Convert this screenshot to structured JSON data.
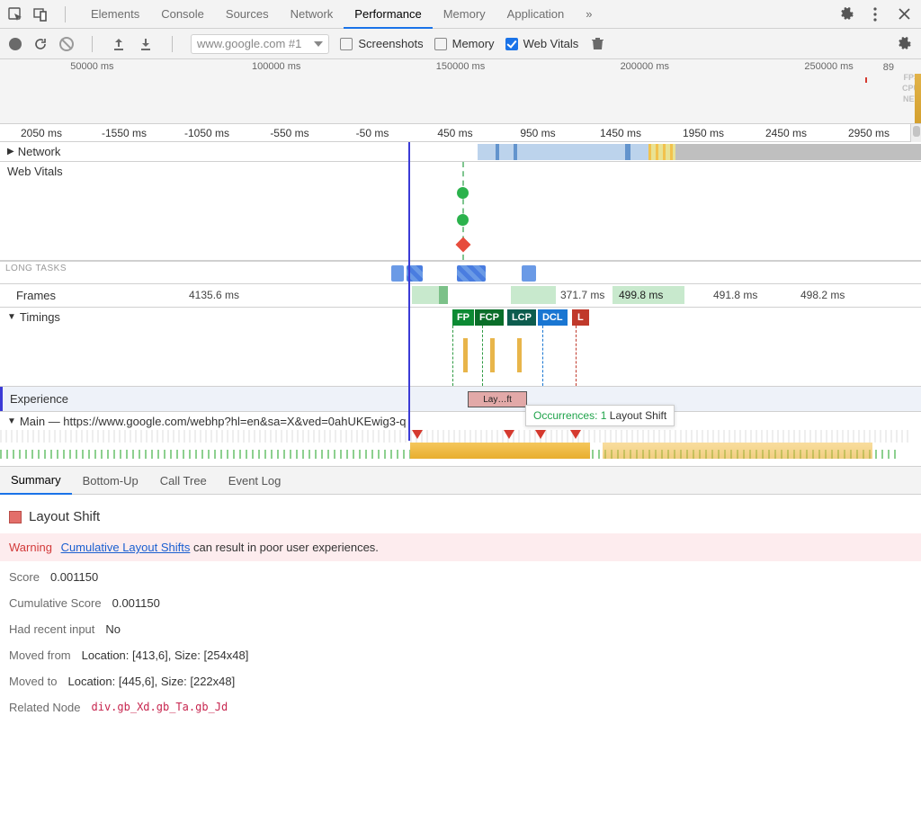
{
  "tabs": {
    "items": [
      "Elements",
      "Console",
      "Sources",
      "Network",
      "Performance",
      "Memory",
      "Application"
    ],
    "active": "Performance"
  },
  "toolbar": {
    "url": "www.google.com #1",
    "screenshots": "Screenshots",
    "memory": "Memory",
    "webvitals": "Web Vitals"
  },
  "overview": {
    "ticks": [
      "50000 ms",
      "100000 ms",
      "150000 ms",
      "200000 ms",
      "250000 ms"
    ],
    "rightVal": "89",
    "labels": [
      "FPS",
      "CPU",
      "NET"
    ]
  },
  "ruler": {
    "ticks": [
      "2050 ms",
      "-1550 ms",
      "-1050 ms",
      "-550 ms",
      "-50 ms",
      "450 ms",
      "950 ms",
      "1450 ms",
      "1950 ms",
      "2450 ms",
      "2950 ms"
    ]
  },
  "rows": {
    "network": "Network",
    "webvitals": "Web Vitals",
    "longtasks": "LONG TASKS",
    "frames": "Frames",
    "timings": "Timings",
    "experience": "Experience",
    "main": "Main — https://www.google.com/webhp?hl=en&sa=X&ved=0ahUKEwig3-q"
  },
  "frames": {
    "v1": "4135.6 ms",
    "v2": "371.7 ms",
    "v3": "499.8 ms",
    "v4": "491.8 ms",
    "v5": "498.2 ms"
  },
  "timing_badges": {
    "fp": "FP",
    "fcp": "FCP",
    "lcp": "LCP",
    "dcl": "DCL",
    "l": "L"
  },
  "experience": {
    "chip": "Lay…ft",
    "tipPrefix": "Occurrences: ",
    "tipCount": "1",
    "tipSuffix": " Layout Shift"
  },
  "subtabs": {
    "items": [
      "Summary",
      "Bottom-Up",
      "Call Tree",
      "Event Log"
    ],
    "active": "Summary"
  },
  "details": {
    "title": "Layout Shift",
    "warnLabel": "Warning",
    "warnLink": "Cumulative Layout Shifts",
    "warnRest": " can result in poor user experiences.",
    "score": {
      "k": "Score",
      "v": "0.001150"
    },
    "cumScore": {
      "k": "Cumulative Score",
      "v": "0.001150"
    },
    "recent": {
      "k": "Had recent input",
      "v": "No"
    },
    "movedFrom": {
      "k": "Moved from",
      "v": "Location: [413,6], Size: [254x48]"
    },
    "movedTo": {
      "k": "Moved to",
      "v": "Location: [445,6], Size: [222x48]"
    },
    "related": {
      "k": "Related Node",
      "v": "div.gb_Xd.gb_Ta.gb_Jd"
    }
  }
}
